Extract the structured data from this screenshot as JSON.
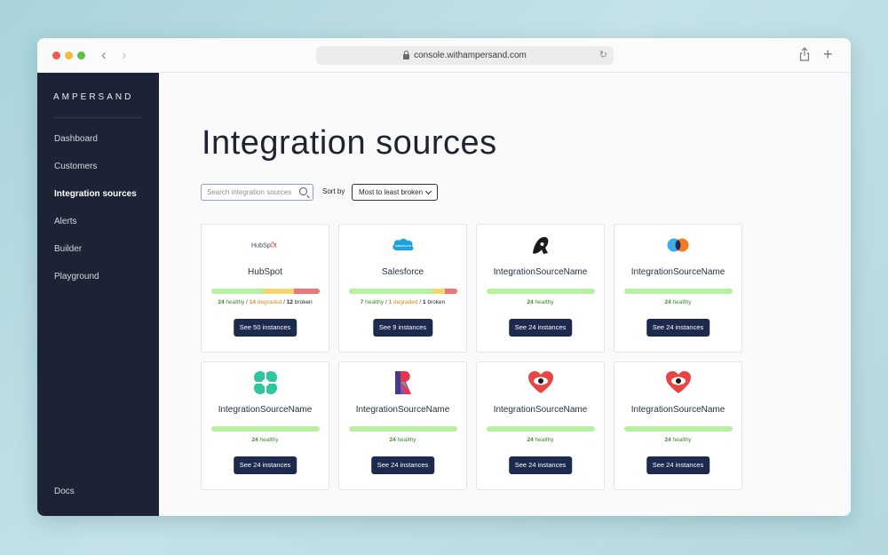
{
  "browser": {
    "url": "console.withampersand.com"
  },
  "sidebar": {
    "brand": "AMPERSAND",
    "items": [
      {
        "label": "Dashboard",
        "active": false
      },
      {
        "label": "Customers",
        "active": false
      },
      {
        "label": "Integration sources",
        "active": true
      },
      {
        "label": "Alerts",
        "active": false
      },
      {
        "label": "Builder",
        "active": false
      },
      {
        "label": "Playground",
        "active": false
      }
    ],
    "footer": [
      {
        "label": "Docs"
      }
    ]
  },
  "main": {
    "title": "Integration sources",
    "search": {
      "placeholder": "Search integration sources"
    },
    "sort": {
      "label": "Sort by",
      "value": "Most to least broken"
    },
    "cards": [
      {
        "name": "HubSpot",
        "logo": "hubspot-logo",
        "healthy": 24,
        "degraded": 14,
        "broken": 12,
        "healthy_label": "healthy",
        "degraded_label": "degraded",
        "broken_label": "broken",
        "button": "See 50 instances"
      },
      {
        "name": "Salesforce",
        "logo": "salesforce-logo",
        "healthy": 7,
        "degraded": 1,
        "broken": 1,
        "healthy_label": "healthy",
        "degraded_label": "degraded",
        "broken_label": "broken",
        "button": "See 9 instances"
      },
      {
        "name": "IntegrationSourceName",
        "logo": "brush-a-logo",
        "healthy": 24,
        "degraded": 0,
        "broken": 0,
        "healthy_label": "healthy",
        "button": "See 24 instances"
      },
      {
        "name": "IntegrationSourceName",
        "logo": "overlap-circles-logo",
        "healthy": 24,
        "degraded": 0,
        "broken": 0,
        "healthy_label": "healthy",
        "button": "See 24 instances"
      },
      {
        "name": "IntegrationSourceName",
        "logo": "clover-logo",
        "healthy": 24,
        "degraded": 0,
        "broken": 0,
        "healthy_label": "healthy",
        "button": "See 24 instances"
      },
      {
        "name": "IntegrationSourceName",
        "logo": "letter-r-logo",
        "healthy": 24,
        "degraded": 0,
        "broken": 0,
        "healthy_label": "healthy",
        "button": "See 24 instances"
      },
      {
        "name": "IntegrationSourceName",
        "logo": "heart-eye-logo",
        "healthy": 24,
        "degraded": 0,
        "broken": 0,
        "healthy_label": "healthy",
        "button": "See 24 instances"
      },
      {
        "name": "IntegrationSourceName",
        "logo": "heart-eye-logo",
        "healthy": 24,
        "degraded": 0,
        "broken": 0,
        "healthy_label": "healthy",
        "button": "See 24 instances"
      }
    ]
  },
  "colors": {
    "sidebar_bg": "#1c2334",
    "button_bg": "#1c2a4e",
    "healthy": "#b8f0a2",
    "degraded": "#f4d76a",
    "broken": "#ef7676"
  }
}
